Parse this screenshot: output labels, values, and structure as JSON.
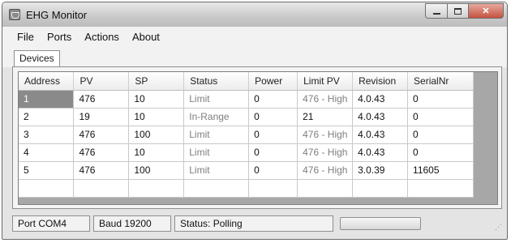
{
  "window": {
    "title": "EHG Monitor"
  },
  "icons": {
    "app": "monitor-icon",
    "minimize": "minimize-icon",
    "maximize": "maximize-icon",
    "close": "close-icon",
    "grip": "resize-grip-icon"
  },
  "menu": {
    "file": "File",
    "ports": "Ports",
    "actions": "Actions",
    "about": "About"
  },
  "tabs": {
    "devices": "Devices"
  },
  "table": {
    "columns": [
      "Address",
      "PV",
      "SP",
      "Status",
      "Power",
      "Limit PV",
      "Revision",
      "SerialNr"
    ],
    "rows": [
      [
        "1",
        "476",
        "10",
        "Limit",
        "0",
        "476 - High",
        "4.0.43",
        "0"
      ],
      [
        "2",
        "19",
        "10",
        "In-Range",
        "0",
        "21",
        "4.0.43",
        "0"
      ],
      [
        "3",
        "476",
        "100",
        "Limit",
        "0",
        "476 - High",
        "4.0.43",
        "0"
      ],
      [
        "4",
        "476",
        "10",
        "Limit",
        "0",
        "476 - High",
        "4.0.43",
        "0"
      ],
      [
        "5",
        "476",
        "100",
        "Limit",
        "0",
        "476 - High",
        "3.0.39",
        "11605"
      ]
    ]
  },
  "status": {
    "port": "Port COM4",
    "baud": "Baud 19200",
    "state": "Status: Polling",
    "progress": 0.0
  },
  "colors": {
    "selection": "#8a8a8a",
    "close_button": "#c5533f"
  }
}
